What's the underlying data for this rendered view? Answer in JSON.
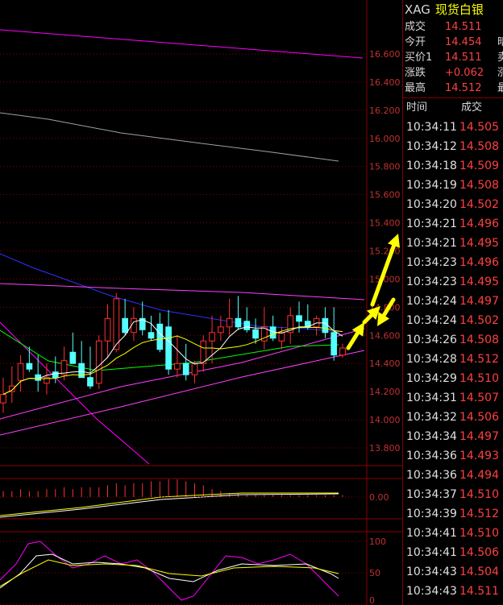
{
  "header": {
    "symbol": "XAG",
    "name": "现货白银"
  },
  "quote": [
    {
      "label": "成交",
      "value": "14.511",
      "extra": ""
    },
    {
      "label": "今开",
      "value": "14.454",
      "extra": "暗"
    },
    {
      "label": "买价1",
      "value": "14.511",
      "extra": "卖"
    },
    {
      "label": "涨跌",
      "value": "+0.062",
      "extra": "涨"
    },
    {
      "label": "最高",
      "value": "14.512",
      "extra": "最"
    }
  ],
  "ticks_header": {
    "time": "时间",
    "price": "成交"
  },
  "ticks": [
    {
      "time": "10:34:11",
      "price": "14.505"
    },
    {
      "time": "10:34:12",
      "price": "14.508"
    },
    {
      "time": "10:34:18",
      "price": "14.509"
    },
    {
      "time": "10:34:19",
      "price": "14.508"
    },
    {
      "time": "10:34:20",
      "price": "14.502"
    },
    {
      "time": "10:34:21",
      "price": "14.496"
    },
    {
      "time": "10:34:21",
      "price": "14.495"
    },
    {
      "time": "10:34:23",
      "price": "14.496"
    },
    {
      "time": "10:34:23",
      "price": "14.495"
    },
    {
      "time": "10:34:24",
      "price": "14.497"
    },
    {
      "time": "10:34:24",
      "price": "14.502"
    },
    {
      "time": "10:34:26",
      "price": "14.508"
    },
    {
      "time": "10:34:28",
      "price": "14.512"
    },
    {
      "time": "10:34:29",
      "price": "14.510"
    },
    {
      "time": "10:34:31",
      "price": "14.507"
    },
    {
      "time": "10:34:32",
      "price": "14.506"
    },
    {
      "time": "10:34:34",
      "price": "14.497"
    },
    {
      "time": "10:34:36",
      "price": "14.493"
    },
    {
      "time": "10:34:36",
      "price": "14.494"
    },
    {
      "time": "10:34:37",
      "price": "14.510"
    },
    {
      "time": "10:34:39",
      "price": "14.512"
    },
    {
      "time": "10:34:41",
      "price": "14.510"
    },
    {
      "time": "10:34:41",
      "price": "14.506"
    },
    {
      "time": "10:34:43",
      "price": "14.504"
    },
    {
      "time": "10:34:43",
      "price": "14.511"
    }
  ],
  "colors": {
    "up": "#ff3030",
    "down": "#54ffff",
    "grid": "#8b0000",
    "axis_text": "#c03030",
    "ma5": "#ffffff",
    "ma10": "#ffff00",
    "ma20": "#ff00ff",
    "ma60": "#00ff00",
    "ma120": "#3030ff",
    "ma250": "#a0a0a0",
    "arrow": "#ffff00",
    "trendline": "#ff40ff"
  },
  "chart_data": [
    {
      "type": "candlestick",
      "y_ticks": [
        "16.600",
        "16.400",
        "16.200",
        "16.000",
        "15.800",
        "15.600",
        "15.400",
        "15.200",
        "15.000",
        "14.800",
        "14.600",
        "14.400",
        "14.200",
        "14.000",
        "13.800"
      ],
      "ylim": [
        13.7,
        16.75
      ],
      "candles": [
        {
          "o": 14.12,
          "h": 14.3,
          "l": 14.05,
          "c": 14.18
        },
        {
          "o": 14.2,
          "h": 14.38,
          "l": 14.12,
          "c": 14.24
        },
        {
          "o": 14.28,
          "h": 14.46,
          "l": 14.2,
          "c": 14.4
        },
        {
          "o": 14.4,
          "h": 14.52,
          "l": 14.34,
          "c": 14.36
        },
        {
          "o": 14.32,
          "h": 14.46,
          "l": 14.2,
          "c": 14.28
        },
        {
          "o": 14.26,
          "h": 14.4,
          "l": 14.18,
          "c": 14.3
        },
        {
          "o": 14.34,
          "h": 14.45,
          "l": 14.26,
          "c": 14.3
        },
        {
          "o": 14.32,
          "h": 14.52,
          "l": 14.28,
          "c": 14.42
        },
        {
          "o": 14.48,
          "h": 14.62,
          "l": 14.4,
          "c": 14.4
        },
        {
          "o": 14.4,
          "h": 14.56,
          "l": 14.3,
          "c": 14.3
        },
        {
          "o": 14.3,
          "h": 14.52,
          "l": 14.22,
          "c": 14.24
        },
        {
          "o": 14.26,
          "h": 14.6,
          "l": 14.22,
          "c": 14.56
        },
        {
          "o": 14.56,
          "h": 14.82,
          "l": 14.44,
          "c": 14.72
        },
        {
          "o": 14.5,
          "h": 14.9,
          "l": 14.48,
          "c": 14.86
        },
        {
          "o": 14.72,
          "h": 14.86,
          "l": 14.6,
          "c": 14.62
        },
        {
          "o": 14.62,
          "h": 14.8,
          "l": 14.56,
          "c": 14.72
        },
        {
          "o": 14.72,
          "h": 14.84,
          "l": 14.6,
          "c": 14.64
        },
        {
          "o": 14.62,
          "h": 14.74,
          "l": 14.56,
          "c": 14.58
        },
        {
          "o": 14.68,
          "h": 14.76,
          "l": 14.48,
          "c": 14.5
        },
        {
          "o": 14.66,
          "h": 14.78,
          "l": 14.32,
          "c": 14.36
        },
        {
          "o": 14.36,
          "h": 14.6,
          "l": 14.3,
          "c": 14.4
        },
        {
          "o": 14.4,
          "h": 14.54,
          "l": 14.28,
          "c": 14.32
        },
        {
          "o": 14.32,
          "h": 14.42,
          "l": 14.26,
          "c": 14.4
        },
        {
          "o": 14.4,
          "h": 14.6,
          "l": 14.34,
          "c": 14.56
        },
        {
          "o": 14.56,
          "h": 14.74,
          "l": 14.4,
          "c": 14.62
        },
        {
          "o": 14.62,
          "h": 14.74,
          "l": 14.56,
          "c": 14.66
        },
        {
          "o": 14.66,
          "h": 14.86,
          "l": 14.6,
          "c": 14.72
        },
        {
          "o": 14.72,
          "h": 14.88,
          "l": 14.64,
          "c": 14.66
        },
        {
          "o": 14.7,
          "h": 14.8,
          "l": 14.62,
          "c": 14.64
        },
        {
          "o": 14.64,
          "h": 14.72,
          "l": 14.54,
          "c": 14.58
        },
        {
          "o": 14.56,
          "h": 14.8,
          "l": 14.5,
          "c": 14.66
        },
        {
          "o": 14.66,
          "h": 14.74,
          "l": 14.56,
          "c": 14.58
        },
        {
          "o": 14.56,
          "h": 14.66,
          "l": 14.5,
          "c": 14.62
        },
        {
          "o": 14.62,
          "h": 14.8,
          "l": 14.54,
          "c": 14.74
        },
        {
          "o": 14.74,
          "h": 14.84,
          "l": 14.62,
          "c": 14.7
        },
        {
          "o": 14.7,
          "h": 14.82,
          "l": 14.64,
          "c": 14.66
        },
        {
          "o": 14.66,
          "h": 14.74,
          "l": 14.6,
          "c": 14.72
        },
        {
          "o": 14.72,
          "h": 14.8,
          "l": 14.58,
          "c": 14.62
        },
        {
          "o": 14.62,
          "h": 14.8,
          "l": 14.42,
          "c": 14.46
        },
        {
          "o": 14.46,
          "h": 14.54,
          "l": 14.44,
          "c": 14.51
        }
      ]
    },
    {
      "type": "bar",
      "name": "volume",
      "y_ticks": [
        "0.00"
      ],
      "values": [
        0.3,
        0.3,
        0.4,
        0.3,
        0.3,
        0.4,
        0.4,
        0.5,
        0.4,
        0.5,
        0.5,
        0.5,
        0.6,
        0.7,
        0.6,
        0.7,
        0.7,
        0.8,
        0.8,
        0.9,
        0.9,
        0.8,
        0.7,
        0.6,
        0.4,
        0.3,
        0.2,
        0.2,
        0.1,
        0.1,
        0.1,
        0.1,
        0.1,
        0.1,
        0.1,
        0.1,
        0.1,
        0.1,
        0.1,
        0.1
      ]
    },
    {
      "type": "line",
      "name": "oscillator",
      "y_ticks": [
        "100",
        "50",
        "0"
      ],
      "ylim": [
        0,
        100
      ]
    }
  ]
}
